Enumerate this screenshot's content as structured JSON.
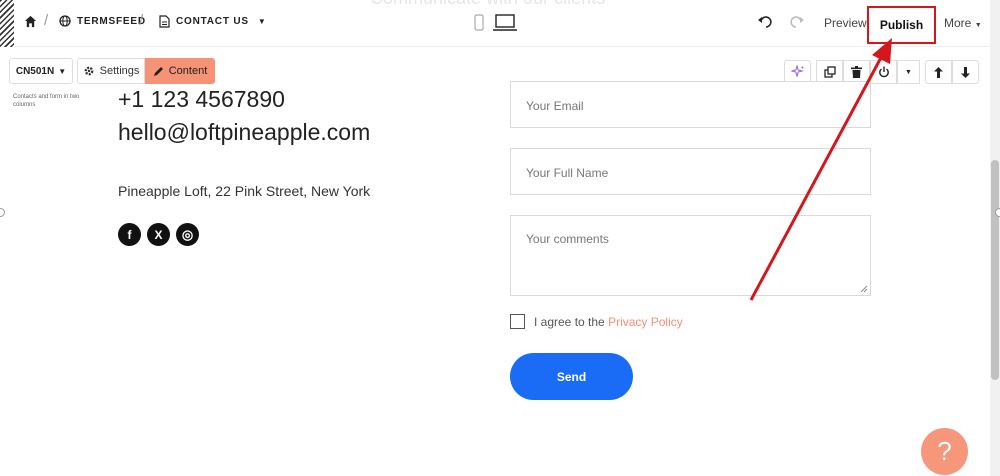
{
  "topbar": {
    "ghost_heading": "Communicate with our clients",
    "breadcrumb_site": "TERMSFEED",
    "breadcrumb_page": "CONTACT US",
    "preview": "Preview",
    "publish": "Publish",
    "more": "More"
  },
  "toolbar": {
    "block_id": "CN501N",
    "settings": "Settings",
    "content": "Content",
    "block_description": "Contacts and form in two columns"
  },
  "contact": {
    "phone": "+1 123 4567890",
    "email": "hello@loftpineapple.com",
    "address": "Pineapple Loft, 22 Pink Street, New York",
    "social": [
      {
        "icon": "facebook-icon",
        "glyph": "f"
      },
      {
        "icon": "x-icon",
        "glyph": "X"
      },
      {
        "icon": "instagram-icon",
        "glyph": "◎"
      }
    ]
  },
  "form": {
    "email_placeholder": "Your Email",
    "name_placeholder": "Your Full Name",
    "comments_placeholder": "Your comments",
    "agree_text": "I agree to the ",
    "privacy_link": "Privacy Policy",
    "send": "Send"
  },
  "help": "?",
  "colors": {
    "accent": "#f69275",
    "send_button": "#1a6bf5",
    "annotation_red": "#d3171c",
    "link": "#f29076"
  }
}
